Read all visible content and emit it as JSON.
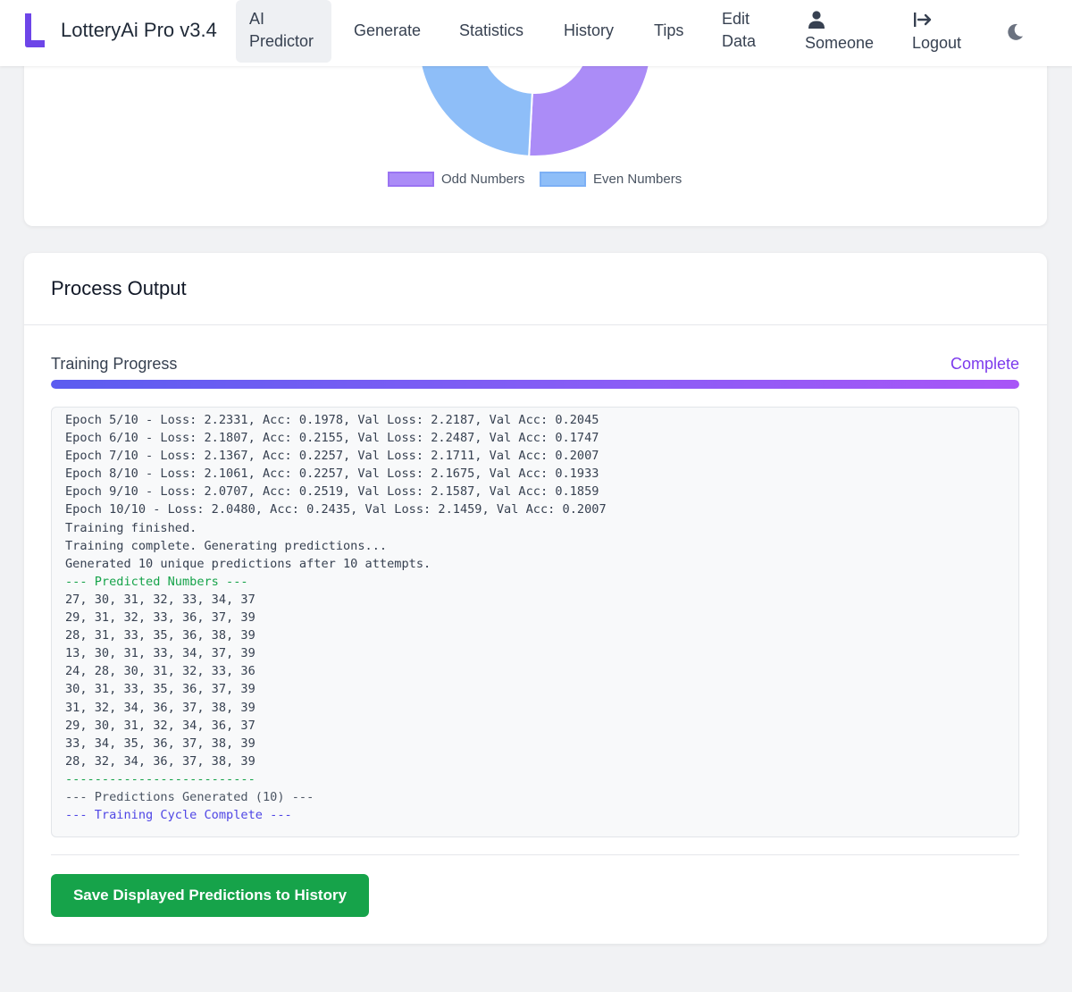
{
  "nav": {
    "brand": "LotteryAi Pro v3.4",
    "items": {
      "ai_predictor_line1": "AI",
      "ai_predictor_line2": "Predictor",
      "generate": "Generate",
      "statistics": "Statistics",
      "history": "History",
      "tips": "Tips",
      "edit_line1": "Edit",
      "edit_line2": "Data",
      "user": "Someone",
      "logout": "Logout"
    },
    "icons": {
      "brand": "brand-logo-icon",
      "user": "user-icon",
      "logout": "logout-icon",
      "theme": "moon-icon"
    },
    "accent": "#6d45e8"
  },
  "chart_data": {
    "type": "pie",
    "variant": "doughnut",
    "categories": [
      "Odd Numbers",
      "Even Numbers"
    ],
    "series": [
      {
        "values": [
          56,
          44
        ]
      }
    ],
    "colors": [
      "#ab8cf7",
      "#8ebef8"
    ],
    "borders": [
      "#9a74f2",
      "#7db0f5"
    ],
    "legend": "bottom"
  },
  "output": {
    "title": "Process Output",
    "progress_label": "Training Progress",
    "progress_status": "Complete",
    "progress_value": 1.0,
    "log_lines": [
      "Epoch 5/10 - Loss: 2.2331, Acc: 0.1978, Val Loss: 2.2187, Val Acc: 0.2045",
      "Epoch 6/10 - Loss: 2.1807, Acc: 0.2155, Val Loss: 2.2487, Val Acc: 0.1747",
      "Epoch 7/10 - Loss: 2.1367, Acc: 0.2257, Val Loss: 2.1711, Val Acc: 0.2007",
      "Epoch 8/10 - Loss: 2.1061, Acc: 0.2257, Val Loss: 2.1675, Val Acc: 0.1933",
      "Epoch 9/10 - Loss: 2.0707, Acc: 0.2519, Val Loss: 2.1587, Val Acc: 0.1859",
      "Epoch 10/10 - Loss: 2.0480, Acc: 0.2435, Val Loss: 2.1459, Val Acc: 0.2007",
      "Training finished.",
      "Training complete. Generating predictions...",
      "Generated 10 unique predictions after 10 attempts."
    ],
    "predicted_header": "--- Predicted Numbers ---",
    "predictions": [
      "27, 30, 31, 32, 33, 34, 37",
      "29, 31, 32, 33, 36, 37, 39",
      "28, 31, 33, 35, 36, 38, 39",
      "13, 30, 31, 33, 34, 37, 39",
      "24, 28, 30, 31, 32, 33, 36",
      "30, 31, 33, 35, 36, 37, 39",
      "31, 32, 34, 36, 37, 38, 39",
      "29, 30, 31, 32, 34, 36, 37",
      "33, 34, 35, 36, 37, 38, 39",
      "28, 32, 34, 36, 37, 38, 39"
    ],
    "separator": "--------------------------",
    "generated_line": "--- Predictions Generated (10) ---",
    "complete_line": "--- Training Cycle Complete ---",
    "save_button": "Save Displayed Predictions to History"
  }
}
